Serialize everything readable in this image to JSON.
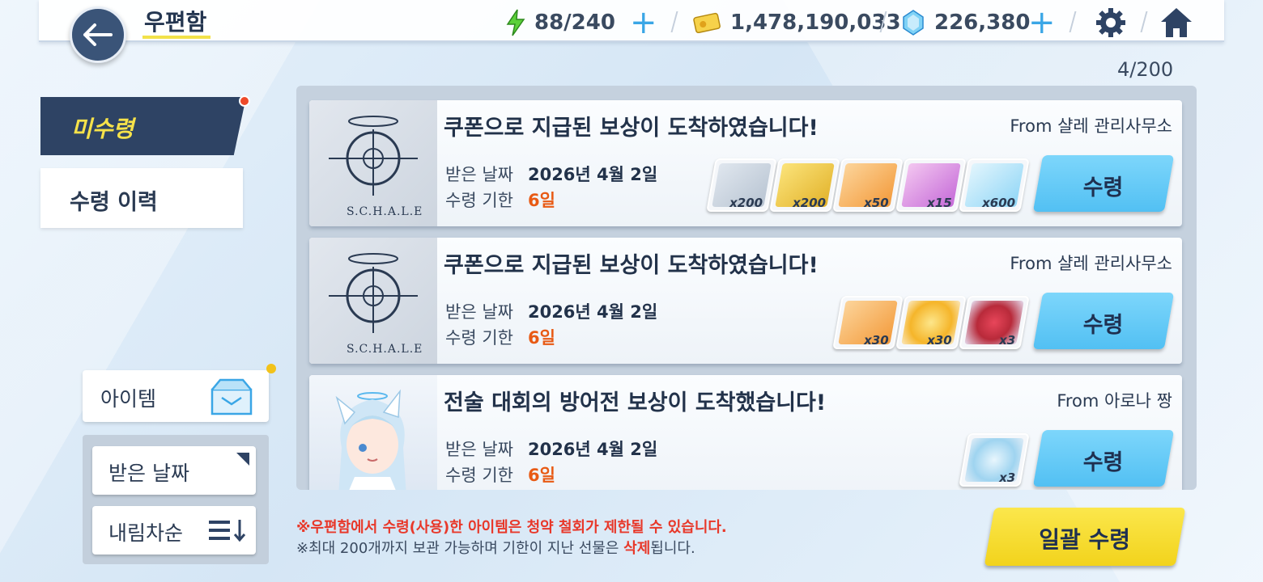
{
  "header": {
    "title": "우편함",
    "ap": "88/240",
    "credits": "1,478,190,033",
    "gems": "226,380"
  },
  "mail_count": "4/200",
  "tabs": {
    "unclaimed": "미수령",
    "history": "수령 이력"
  },
  "filter": {
    "category": "아이템",
    "sort_key": "받은 날짜",
    "sort_order": "내림차순"
  },
  "labels": {
    "received_date": "받은 날짜",
    "deadline": "수령 기한",
    "claim": "수령"
  },
  "mails": [
    {
      "title": "쿠폰으로 지급된 보상이 도착하였습니다!",
      "from": "From 샬레 관리사무소",
      "thumb_text": "S.C.H.A.L.E",
      "date": "2026년 4월 2일",
      "expiry": "6일",
      "items": [
        {
          "icon": "gift-box-icon",
          "qty": "x200"
        },
        {
          "icon": "gold-box-icon",
          "qty": "x200"
        },
        {
          "icon": "report-orange-icon",
          "qty": "x50"
        },
        {
          "icon": "report-purple-icon",
          "qty": "x15"
        },
        {
          "icon": "gem-icon",
          "qty": "x600"
        }
      ]
    },
    {
      "title": "쿠폰으로 지급된 보상이 도착하였습니다!",
      "from": "From 샬레 관리사무소",
      "thumb_text": "S.C.H.A.L.E",
      "date": "2026년 4월 2일",
      "expiry": "6일",
      "items": [
        {
          "icon": "report-orange-icon",
          "qty": "x30"
        },
        {
          "icon": "gold-coin-icon",
          "qty": "x30"
        },
        {
          "icon": "bouquet-icon",
          "qty": "x3"
        }
      ]
    },
    {
      "title": "전술 대회의 방어전 보상이 도착했습니다!",
      "from": "From 아로나 짱",
      "thumb_text": "",
      "date": "2026년 4월 2일",
      "expiry": "6일",
      "items": [
        {
          "icon": "coin-token-icon",
          "qty": "x3"
        }
      ]
    }
  ],
  "notices": {
    "line1": "※우편함에서 수령(사용)한 아이템은 청약 철회가 제한될 수 있습니다.",
    "line2_a": "※최대 200개까지 보관 가능하며 기한이 지난 선물은 ",
    "line2_b": "삭제",
    "line2_c": "됩니다."
  },
  "bulk_claim": "일괄 수령",
  "colors": {
    "navy": "#2e4364",
    "accent_yellow": "#f6e24a",
    "claim_blue": "#52c0f3",
    "warning_red": "#e8382a",
    "expiry_orange": "#e85a14"
  }
}
